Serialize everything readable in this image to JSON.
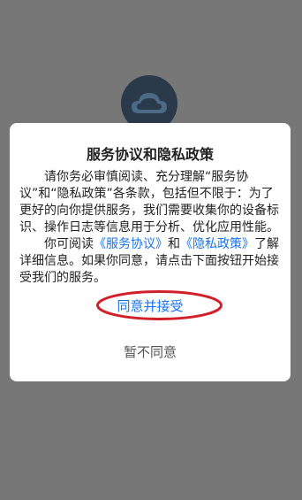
{
  "dialog": {
    "title": "服务协议和隐私政策",
    "para1": "请你务必审慎阅读、充分理解“服务协议”和“隐私政策”各条款，包括但不限于：为了更好的向你提供服务，我们需要收集你的设备标识、操作日志等信息用于分析、优化应用性能。",
    "para2_prefix": "你可阅读",
    "link_service": "《服务协议》",
    "para2_and": "和",
    "link_privacy": "《隐私政策》",
    "para2_suffix": "了解详细信息。如果你同意，请点击下面按钮开始接受我们的服务。",
    "accept_label": "同意并接受",
    "decline_label": "暂不同意"
  },
  "colors": {
    "overlay": "#777777",
    "link": "#1a73e8",
    "highlight": "#d0202a"
  },
  "icons": {
    "app_logo": "cloud-icon"
  }
}
